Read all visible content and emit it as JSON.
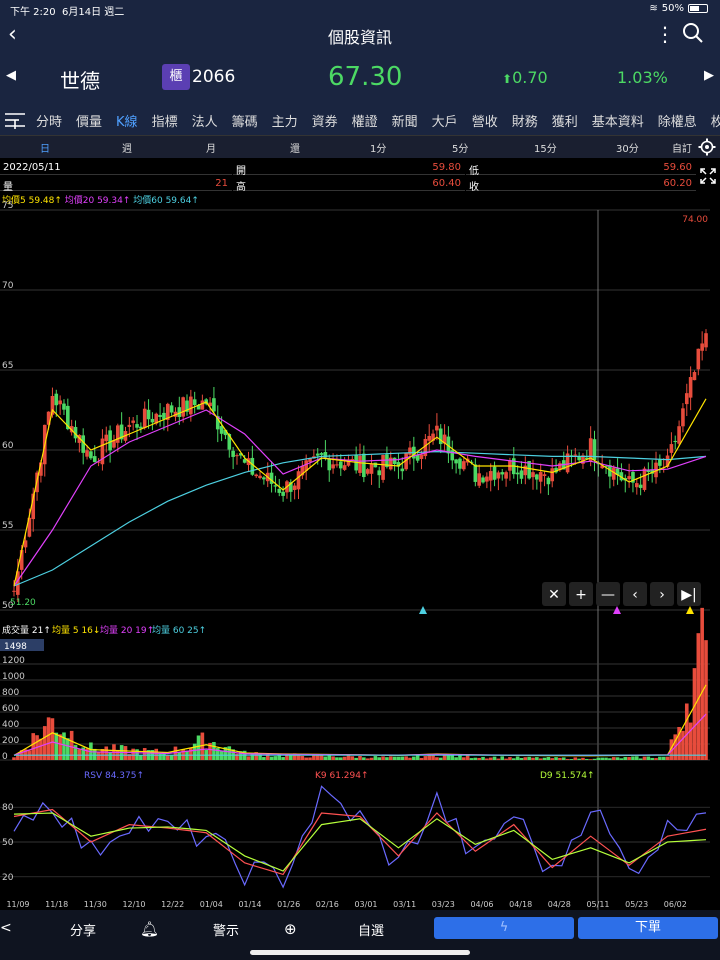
{
  "status": {
    "time": "下午 2:20",
    "date": "6月14日 週二",
    "battery": "50%"
  },
  "nav": {
    "title": "個股資訊"
  },
  "quote": {
    "name": "世德",
    "badge": "櫃",
    "code": "2066",
    "price": "67.30",
    "change": "0.70",
    "percent": "1.03%"
  },
  "tabs": [
    "分時",
    "價量",
    "K線",
    "指標",
    "法人",
    "籌碼",
    "主力",
    "資券",
    "權證",
    "新聞",
    "大戶",
    "營收",
    "財務",
    "獲利",
    "基本資料",
    "除權息",
    "枚"
  ],
  "active_tab": "K線",
  "periods": [
    "日",
    "週",
    "月",
    "還",
    "1分",
    "5分",
    "15分",
    "30分",
    "自訂"
  ],
  "info": {
    "date": "2022/05/11",
    "vol_label": "量",
    "vol_val": "21",
    "open_label": "開",
    "open_val": "59.80",
    "high_label": "高",
    "high_val": "60.40",
    "low_label": "低",
    "low_val": "59.60",
    "close_label": "收",
    "close_val": "60.20"
  },
  "ma_legend": [
    {
      "label": "均價5 59.48",
      "color": "#ffe400"
    },
    {
      "label": "均價20 59.34",
      "color": "#e040fb"
    },
    {
      "label": "均價60 59.64",
      "color": "#4dd0e1"
    }
  ],
  "price_axis": {
    "ticks": [
      "75",
      "70",
      "65",
      "60",
      "55",
      "50"
    ],
    "max_label": "74.00",
    "min_label": "51.20"
  },
  "chart_controls": [
    "✕",
    "+",
    "—",
    "‹",
    "›",
    "▶|"
  ],
  "vol_legend": [
    {
      "label": "成交量 21",
      "color": "#ffffff"
    },
    {
      "label": "均量 5 16",
      "color": "#ffe400"
    },
    {
      "label": "均量 20 19",
      "color": "#e040fb"
    },
    {
      "label": "均量 60 25",
      "color": "#4dd0e1"
    }
  ],
  "vol_axis": {
    "badge": "1498",
    "ticks": [
      "1200",
      "1000",
      "800",
      "600",
      "400",
      "200",
      "0"
    ]
  },
  "kd_legend": [
    {
      "label": "RSV 84.375",
      "color": "#6a6aff"
    },
    {
      "label": "K9 61.294",
      "color": "#ff5252"
    },
    {
      "label": "D9 51.574",
      "color": "#b6ff3b"
    }
  ],
  "kd_axis": {
    "ticks": [
      "80",
      "50",
      "20"
    ]
  },
  "dates": [
    "11/09",
    "11/18",
    "11/30",
    "12/10",
    "12/22",
    "01/04",
    "01/14",
    "01/26",
    "02/16",
    "03/01",
    "03/11",
    "03/23",
    "04/06",
    "04/18",
    "04/28",
    "05/11",
    "05/23",
    "06/02"
  ],
  "bottom": {
    "share": "分享",
    "alert": "警示",
    "watch": "自選",
    "order": "下單"
  },
  "colors": {
    "up": "#e74c3c",
    "down": "#4cd964",
    "ma5": "#ffe400",
    "ma20": "#e040fb",
    "ma60": "#4dd0e1"
  },
  "chart_data": [
    {
      "type": "candlestick",
      "title": "",
      "ylim": [
        50,
        75
      ],
      "x": [
        "11/09",
        "11/18",
        "11/30",
        "12/10",
        "12/22",
        "01/04",
        "01/14",
        "01/26",
        "02/16",
        "03/01",
        "03/11",
        "03/23",
        "04/06",
        "04/18",
        "04/28",
        "05/11",
        "05/23",
        "06/02",
        "06/14"
      ],
      "close": [
        51.2,
        63.5,
        59.5,
        61.5,
        62.5,
        63.0,
        59.0,
        57.5,
        59.5,
        59.0,
        59.0,
        61.0,
        58.5,
        59.0,
        58.5,
        60.2,
        57.8,
        59.0,
        67.3
      ],
      "ma5": [
        51.5,
        62.5,
        60.0,
        61.0,
        62.0,
        63.0,
        59.5,
        57.5,
        59.5,
        59.2,
        59.0,
        60.8,
        59.0,
        59.0,
        58.6,
        59.5,
        58.0,
        59.0,
        63.2
      ],
      "ma20": [
        51.5,
        55.0,
        59.0,
        60.5,
        61.5,
        62.5,
        61.0,
        58.5,
        59.5,
        59.3,
        59.4,
        60.0,
        59.6,
        59.3,
        59.0,
        59.3,
        58.7,
        58.8,
        59.6
      ],
      "ma60": [
        51.5,
        52.5,
        54.0,
        55.5,
        56.8,
        57.8,
        58.6,
        59.2,
        59.6,
        59.7,
        59.8,
        59.9,
        59.8,
        59.7,
        59.6,
        59.6,
        59.5,
        59.4,
        59.6
      ]
    },
    {
      "type": "bar",
      "title": "",
      "ylim": [
        0,
        1500
      ],
      "x": [
        "11/09",
        "11/18",
        "11/30",
        "12/10",
        "12/22",
        "01/04",
        "01/14",
        "01/26",
        "02/16",
        "03/01",
        "03/11",
        "03/23",
        "04/06",
        "04/18",
        "04/28",
        "05/11",
        "05/23",
        "06/02",
        "06/14"
      ],
      "values": [
        30,
        500,
        150,
        120,
        90,
        250,
        80,
        60,
        50,
        40,
        30,
        60,
        40,
        30,
        25,
        21,
        30,
        40,
        1498
      ]
    },
    {
      "type": "line",
      "title": "",
      "ylim": [
        0,
        100
      ],
      "x": [
        "11/09",
        "11/18",
        "11/30",
        "12/10",
        "12/22",
        "01/04",
        "01/14",
        "01/26",
        "02/16",
        "03/01",
        "03/11",
        "03/23",
        "04/06",
        "04/18",
        "04/28",
        "05/11",
        "05/23",
        "06/02",
        "06/14"
      ],
      "series": [
        {
          "name": "RSV",
          "values": [
            70,
            85,
            40,
            70,
            60,
            55,
            25,
            20,
            90,
            70,
            30,
            85,
            35,
            75,
            20,
            84,
            25,
            60,
            84
          ]
        },
        {
          "name": "K9",
          "values": [
            72,
            78,
            50,
            65,
            62,
            58,
            32,
            22,
            75,
            72,
            38,
            75,
            42,
            65,
            28,
            55,
            30,
            55,
            61
          ]
        },
        {
          "name": "D9",
          "values": [
            74,
            75,
            55,
            62,
            63,
            60,
            38,
            25,
            65,
            70,
            45,
            70,
            48,
            60,
            35,
            45,
            32,
            50,
            52
          ]
        }
      ]
    }
  ]
}
